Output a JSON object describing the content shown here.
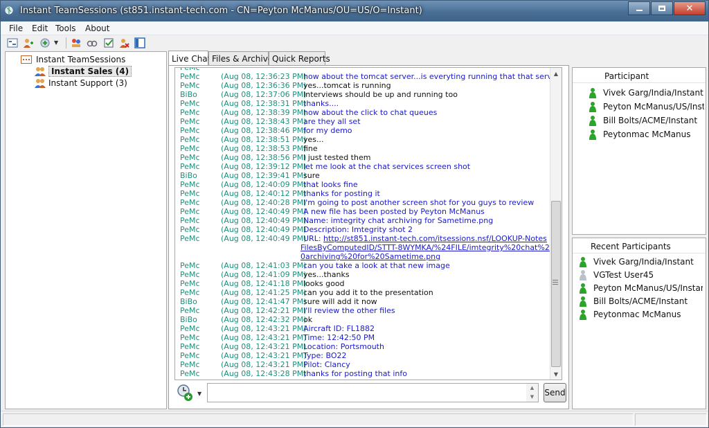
{
  "window": {
    "title": "Instant TeamSessions (st851.instant-tech.com - CN=Peyton McManus/OU=US/O=Instant)",
    "controls": [
      "minimize",
      "maximize",
      "close"
    ]
  },
  "menu": [
    "File",
    "Edit",
    "Tools",
    "About"
  ],
  "toolbar": {
    "icons": [
      "view-tree-icon",
      "add-user-icon",
      "add-group-icon",
      "dropdown-arrow-icon",
      "meeting-icon",
      "privacy-icon",
      "checklist-icon",
      "remove-user-icon",
      "panel-toggle-icon"
    ]
  },
  "tree": {
    "root": "Instant TeamSessions",
    "groups": [
      {
        "label": "Instant Sales (4)",
        "selected": true
      },
      {
        "label": "Instant Support (3)",
        "selected": false
      }
    ]
  },
  "tabs": [
    "Live Chat",
    "Files & Archive",
    "Quick Reports"
  ],
  "active_tab": "Live Chat",
  "chat": {
    "messages": [
      {
        "who": "PeMc",
        "when": "(Aug 08, 12:36:23 PM)",
        "text": "how about the tomcat server...is everyting running that that services?",
        "color": "blue"
      },
      {
        "who": "PeMc",
        "when": "(Aug 08, 12:36:36 PM)",
        "text": "yes...tomcat is running",
        "color": "black"
      },
      {
        "who": "BiBo",
        "when": "(Aug 08, 12:37:06 PM)",
        "text": "Interviews should be up and running too",
        "color": "black"
      },
      {
        "who": "PeMc",
        "when": "(Aug 08, 12:38:31 PM)",
        "text": "thanks....",
        "color": "blue"
      },
      {
        "who": "PeMc",
        "when": "(Aug 08, 12:38:39 PM)",
        "text": "how about the click to chat queues",
        "color": "blue"
      },
      {
        "who": "PeMc",
        "when": "(Aug 08, 12:38:43 PM)",
        "text": "are they all set",
        "color": "blue"
      },
      {
        "who": "PeMc",
        "when": "(Aug 08, 12:38:46 PM)",
        "text": "for my demo",
        "color": "blue"
      },
      {
        "who": "PeMc",
        "when": "(Aug 08, 12:38:51 PM)",
        "text": "yes...",
        "color": "black"
      },
      {
        "who": "PeMc",
        "when": "(Aug 08, 12:38:53 PM)",
        "text": "fine",
        "color": "black"
      },
      {
        "who": "PeMc",
        "when": "(Aug 08, 12:38:56 PM)",
        "text": "I just tested them",
        "color": "black"
      },
      {
        "who": "PeMc",
        "when": "(Aug 08, 12:39:12 PM)",
        "text": "let me look at the chat services screen shot",
        "color": "blue"
      },
      {
        "who": "BiBo",
        "when": "(Aug 08, 12:39:41 PM)",
        "text": "sure",
        "color": "black"
      },
      {
        "who": "PeMc",
        "when": "(Aug 08, 12:40:09 PM)",
        "text": "that looks fine",
        "color": "blue"
      },
      {
        "who": "PeMc",
        "when": "(Aug 08, 12:40:12 PM)",
        "text": "thanks for posting it",
        "color": "blue"
      },
      {
        "who": "PeMc",
        "when": "(Aug 08, 12:40:28 PM)",
        "text": "I'm going to post another screen shot for you guys to review",
        "color": "blue"
      },
      {
        "who": "PeMc",
        "when": "(Aug 08, 12:40:49 PM)",
        "text": "A new file has been posted by Peyton McManus",
        "color": "blue"
      },
      {
        "who": "PeMc",
        "when": "(Aug 08, 12:40:49 PM)",
        "text": "Name: imtegrity chat archiving for Sametime.png",
        "color": "blue"
      },
      {
        "who": "PeMc",
        "when": "(Aug 08, 12:40:49 PM)",
        "text": "Description: Imtegrity shot 2",
        "color": "blue"
      }
    ],
    "url_message": {
      "who": "PeMc",
      "when": "(Aug 08, 12:40:49 PM)",
      "label": "URL: ",
      "link": "http://st851.instant-tech.com/itsessions.nsf/LOOKUP-NotesFilesByComputedID/STTT-8WYMKA/%24FILE/imtegrity%20chat%20archiving%20for%20Sametime.png"
    },
    "messages_after": [
      {
        "who": "PeMc",
        "when": "(Aug 08, 12:41:03 PM)",
        "text": "can you take a look at that new image",
        "color": "blue"
      },
      {
        "who": "PeMc",
        "when": "(Aug 08, 12:41:09 PM)",
        "text": "yes...thanks",
        "color": "black"
      },
      {
        "who": "PeMc",
        "when": "(Aug 08, 12:41:18 PM)",
        "text": "looks good",
        "color": "black"
      },
      {
        "who": "PeMc",
        "when": "(Aug 08, 12:41:25 PM)",
        "text": "can you add it to the presentation",
        "color": "black"
      },
      {
        "who": "BiBo",
        "when": "(Aug 08, 12:41:47 PM)",
        "text": "sure will add it now",
        "color": "black"
      },
      {
        "who": "PeMc",
        "when": "(Aug 08, 12:42:21 PM)",
        "text": "I'll review the other files",
        "color": "blue"
      },
      {
        "who": "BiBo",
        "when": "(Aug 08, 12:42:32 PM)",
        "text": "ok",
        "color": "black"
      },
      {
        "who": "PeMc",
        "when": "(Aug 08, 12:43:21 PM)",
        "text": "Aircraft ID: FL1882",
        "color": "blue"
      },
      {
        "who": "PeMc",
        "when": "(Aug 08, 12:43:21 PM)",
        "text": "Time: 12:42:50 PM",
        "color": "blue"
      },
      {
        "who": "PeMc",
        "when": "(Aug 08, 12:43:21 PM)",
        "text": "Location: Portsmouth",
        "color": "blue"
      },
      {
        "who": "PeMc",
        "when": "(Aug 08, 12:43:21 PM)",
        "text": "Type: BO22",
        "color": "blue"
      },
      {
        "who": "PeMc",
        "when": "(Aug 08, 12:43:21 PM)",
        "text": "Pilot: Clancy",
        "color": "blue"
      },
      {
        "who": "PeMc",
        "when": "(Aug 08, 12:43:28 PM)",
        "text": "thanks for posting that info",
        "color": "blue"
      }
    ]
  },
  "compose": {
    "value": "",
    "send_label": "Send"
  },
  "participants": {
    "header": "Participant",
    "items": [
      "Vivek Garg/India/Instant",
      "Peyton McManus/US/Instant",
      "Bill Bolts/ACME/Instant",
      "Peytonmac McManus"
    ]
  },
  "recent": {
    "header": "Recent Participants",
    "items": [
      {
        "name": "Vivek Garg/India/Instant",
        "status": "online"
      },
      {
        "name": "VGTest User45",
        "status": "offline"
      },
      {
        "name": "Peyton McManus/US/Instant",
        "status": "online"
      },
      {
        "name": "Bill Bolts/ACME/Instant",
        "status": "online"
      },
      {
        "name": "Peytonmac McManus",
        "status": "online"
      }
    ]
  },
  "colors": {
    "blue_text": "#1a1aca",
    "nick": "#1e8f7c",
    "online": "#2aa52a",
    "offline": "#b9c2c9"
  }
}
